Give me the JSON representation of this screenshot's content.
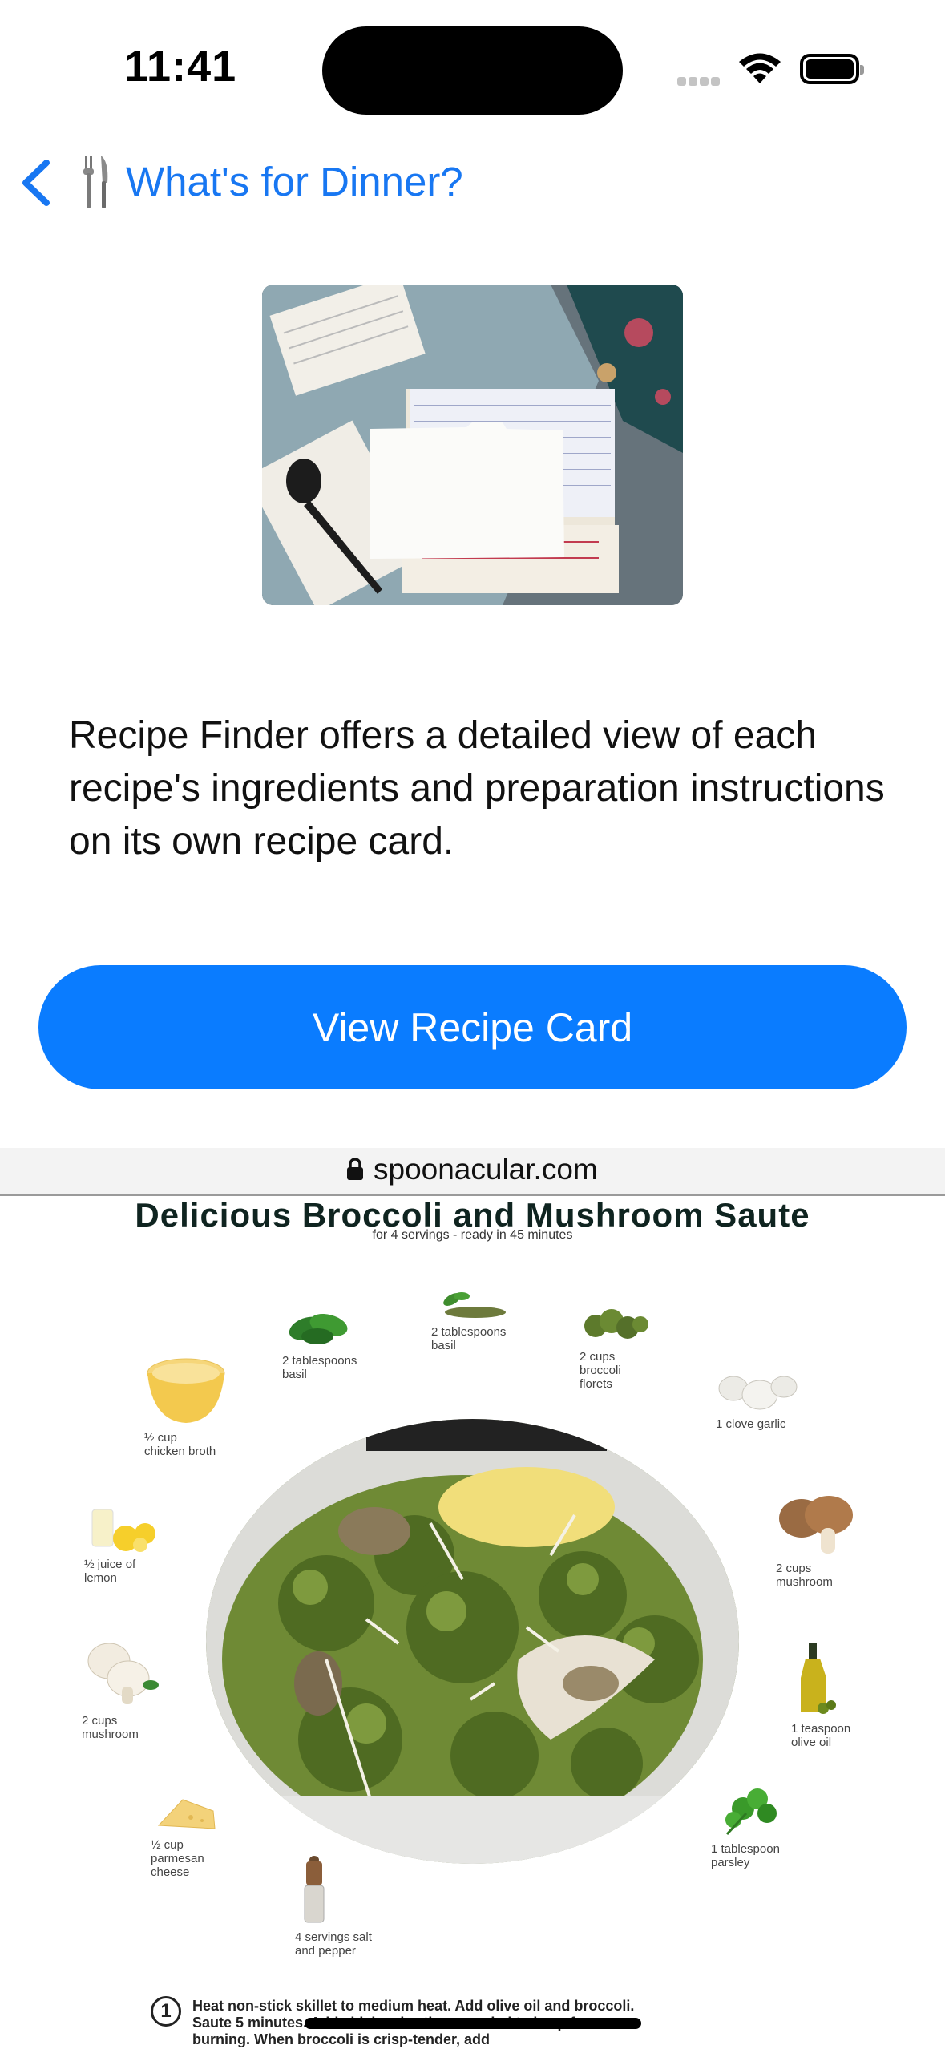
{
  "status_bar": {
    "time": "11:41"
  },
  "nav": {
    "title": "What's for Dinner?"
  },
  "description": "Recipe Finder offers a detailed view of each recipe's ingredients and preparation instructions on its own recipe card.",
  "cta_label": "View Recipe Card",
  "web": {
    "url": "spoonacular.com",
    "title": "Delicious Broccoli and Mushroom Saute",
    "subtitle": "for 4 servings - ready in 45 minutes",
    "ingredients": [
      {
        "id": "basil-1",
        "line1": "2 tablespoons",
        "line2": "basil"
      },
      {
        "id": "basil-2",
        "line1": "2 tablespoons",
        "line2": "basil"
      },
      {
        "id": "broccoli",
        "line1": "2 cups",
        "line2": "broccoli",
        "line3": "florets"
      },
      {
        "id": "garlic",
        "line1": "1 clove garlic"
      },
      {
        "id": "broth",
        "line1": "½ cup",
        "line2": "chicken broth"
      },
      {
        "id": "mushroom-1",
        "line1": "2 cups",
        "line2": "mushroom"
      },
      {
        "id": "lemon",
        "line1": "½ juice of",
        "line2": "lemon"
      },
      {
        "id": "olive-oil",
        "line1": "1 teaspoon",
        "line2": "olive oil"
      },
      {
        "id": "mushroom-2",
        "line1": "2 cups",
        "line2": "mushroom"
      },
      {
        "id": "parsley",
        "line1": "1 tablespoon",
        "line2": "parsley"
      },
      {
        "id": "parmesan",
        "line1": "½ cup",
        "line2": "parmesan",
        "line3": "cheese"
      },
      {
        "id": "salt-pepper",
        "line1": "4 servings salt",
        "line2": "and pepper"
      }
    ],
    "step": {
      "number": "1",
      "text": "Heat non-stick skillet to medium heat. Add olive oil and broccoli. Saute 5 minutes. Add chicken broth as needed to keep from burning.  When broccoli is crisp-tender, add"
    }
  }
}
